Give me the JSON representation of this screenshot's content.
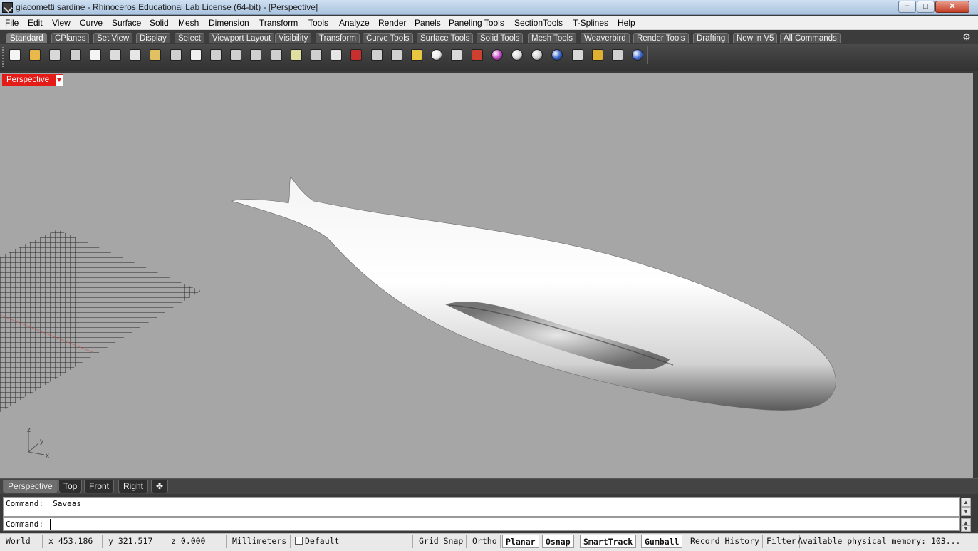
{
  "window": {
    "title": "giacometti sardine - Rhinoceros Educational Lab License (64-bit) - [Perspective]",
    "min_glyph": "−",
    "max_glyph": "□",
    "close_glyph": "✕"
  },
  "menu": [
    "File",
    "Edit",
    "View",
    "Curve",
    "Surface",
    "Solid",
    "Mesh",
    "Dimension",
    "Transform",
    "Tools",
    "Analyze",
    "Render",
    "Panels",
    "Paneling Tools",
    "SectionTools",
    "T-Splines",
    "Help"
  ],
  "toolbar_tabs": [
    "Standard",
    "CPlanes",
    "Set View",
    "Display",
    "Select",
    "Viewport Layout",
    "Visibility",
    "Transform",
    "Curve Tools",
    "Surface Tools",
    "Solid Tools",
    "Mesh Tools",
    "Weaverbird",
    "Render Tools",
    "Drafting",
    "New in V5",
    "All Commands"
  ],
  "toolbar_icons": [
    "new-icon",
    "open-icon",
    "save-icon",
    "print-icon",
    "import-icon",
    "cut-icon",
    "copy-icon",
    "paste-icon",
    "undo-icon",
    "pan-icon",
    "rotate-view-icon",
    "zoom-icon",
    "zoom-window-icon",
    "zoom-extents-icon",
    "zoom-selected-icon",
    "rotate-camera-icon",
    "four-viewports-icon",
    "car-icon",
    "point-icon",
    "curve-icon",
    "object-snap-icon",
    "light-bulb-icon",
    "lock-icon",
    "layer-icon",
    "color-wheel-icon",
    "wireframe-sphere-icon",
    "shaded-sphere-icon",
    "rendered-sphere-icon",
    "material-icon",
    "options-gear-icon",
    "gumball-icon",
    "help-icon"
  ],
  "viewport": {
    "name": "Perspective",
    "axis_labels": {
      "z": "z",
      "y": "y",
      "x": "x"
    }
  },
  "view_tabs": [
    "Perspective",
    "Top",
    "Front",
    "Right"
  ],
  "view_tab_add": "✤",
  "command": {
    "history": "Command: _Saveas",
    "prompt": "Command:",
    "value": ""
  },
  "status": {
    "cplane": "World",
    "x": "x 453.186",
    "y": "y 321.517",
    "z": "z 0.000",
    "units": "Millimeters",
    "layer": "Default",
    "toggles": [
      {
        "label": "Grid Snap",
        "on": false
      },
      {
        "label": "Ortho",
        "on": false
      },
      {
        "label": "Planar",
        "on": true
      },
      {
        "label": "Osnap",
        "on": true
      },
      {
        "label": "SmartTrack",
        "on": true
      },
      {
        "label": "Gumball",
        "on": true
      },
      {
        "label": "Record History",
        "on": false
      },
      {
        "label": "Filter",
        "on": false
      }
    ],
    "memory": "Available physical memory: 103..."
  }
}
